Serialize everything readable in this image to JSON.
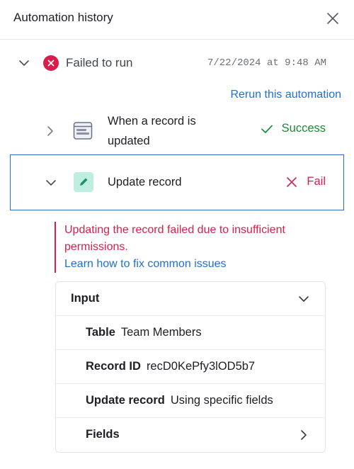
{
  "header": {
    "title": "Automation history"
  },
  "run": {
    "status": "Failed to run",
    "timestamp": "7/22/2024 at 9:48 AM",
    "rerun_label": "Rerun this automation"
  },
  "steps": [
    {
      "label": "When a record is updated",
      "result": "Success",
      "expanded": false
    },
    {
      "label": "Update record",
      "result": "Fail",
      "expanded": true
    }
  ],
  "error": {
    "message": "Updating the record failed due to insufficient permissions.",
    "help_link": "Learn how to fix common issues"
  },
  "input": {
    "title": "Input",
    "fields": [
      {
        "key": "Table",
        "value": "Team Members"
      },
      {
        "key": "Record ID",
        "value": "recD0KePfy3lOD5b7"
      },
      {
        "key": "Update record",
        "value": "Using specific fields"
      },
      {
        "key": "Fields",
        "value": ""
      }
    ]
  },
  "colors": {
    "error": "#d81e4b",
    "success": "#1b8a35",
    "link": "#1e6fd9",
    "selected_border": "#2d6fc4",
    "action_icon_bg": "#bdeee0"
  }
}
